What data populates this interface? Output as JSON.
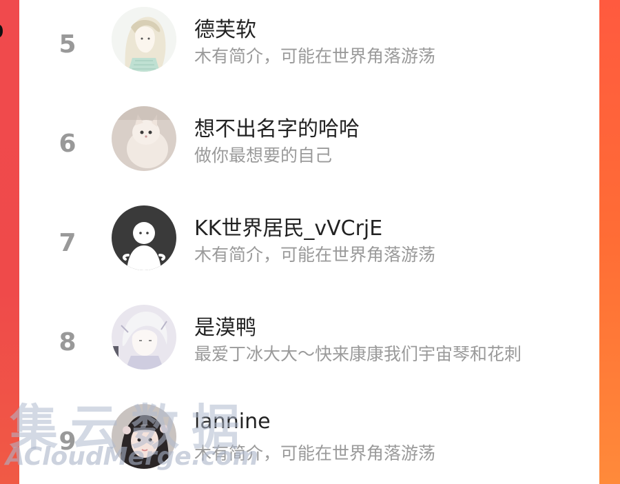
{
  "list": {
    "items": [
      {
        "rank": "5",
        "name": "德芙软",
        "desc": "木有简介，可能在世界角落游荡",
        "avatar": "anime-girl-avatar"
      },
      {
        "rank": "6",
        "name": "想不出名字的哈哈",
        "desc": "做你最想要的自己",
        "avatar": "cat-avatar"
      },
      {
        "rank": "7",
        "name": "KK世界居民_vVCrjE",
        "desc": "木有简介，可能在世界角落游荡",
        "avatar": "default-avatar"
      },
      {
        "rank": "8",
        "name": "是漠鸭",
        "desc": "最爱丁冰大大～快来康康我们宇宙琴和花刺",
        "avatar": "anime-boy-avatar"
      },
      {
        "rank": "9",
        "name": "lannine",
        "desc": "木有简介，可能在世界角落游荡",
        "avatar": "girl-photo-avatar"
      }
    ]
  },
  "watermark": {
    "cn": "集云数据",
    "en": "ACloudMerge.com"
  },
  "colors": {
    "accent_left": "#f04a4d",
    "accent_right": "#ff6d35",
    "rank": "#999999",
    "name": "#222222",
    "desc": "#9a9a9a"
  }
}
